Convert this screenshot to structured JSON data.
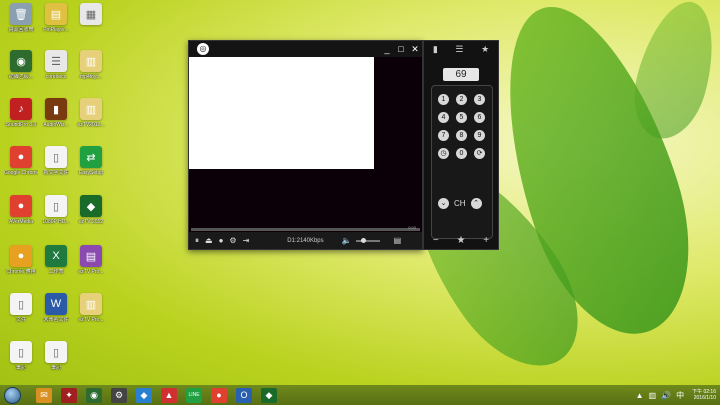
{
  "desktop": {
    "icons": [
      {
        "label": "資源回收筒",
        "glyph": "🗑",
        "color": "#8aa0b0"
      },
      {
        "label": "PotPlayer...",
        "glyph": "▤",
        "color": "#e0c040"
      },
      {
        "label": "",
        "glyph": "▦",
        "color": "#e8e8e8"
      },
      {
        "label": "紡織乙級...",
        "glyph": "◉",
        "color": "#2e6b2e"
      },
      {
        "label": "corelrecs",
        "glyph": "☰",
        "color": "#e8e8e8"
      },
      {
        "label": "mp4toyt...",
        "glyph": "▥",
        "color": "#e6d07a"
      },
      {
        "label": "SoundPro 3.0",
        "glyph": "♪",
        "color": "#c02020"
      },
      {
        "label": "AudioWiz...",
        "glyph": "▮",
        "color": "#7a3a10"
      },
      {
        "label": "ezTV2012...",
        "glyph": "▥",
        "color": "#e6d07a"
      },
      {
        "label": "Google Chrome",
        "glyph": "●",
        "color": "#e04030"
      },
      {
        "label": "新文字文件",
        "glyph": "▯",
        "color": "#f4f4f4"
      },
      {
        "label": "EasySetup",
        "glyph": "⇄",
        "color": "#20a040"
      },
      {
        "label": "AVerMedia",
        "glyph": "●",
        "color": "#e04030"
      },
      {
        "label": "1080P HD...",
        "glyph": "▯",
        "color": "#f4f4f4"
      },
      {
        "label": "ezTV 2012",
        "glyph": "◆",
        "color": "#1a6a2a"
      },
      {
        "label": "Chrome 應用",
        "glyph": "●",
        "color": "#e8a020"
      },
      {
        "label": "工作表",
        "glyph": "X",
        "color": "#1f7a40"
      },
      {
        "label": "ezTV Pro...",
        "glyph": "▤",
        "color": "#8a4ab0"
      },
      {
        "label": "文件",
        "glyph": "▯",
        "color": "#f4f4f4"
      },
      {
        "label": "未命名文件",
        "glyph": "W",
        "color": "#2a5aa8"
      },
      {
        "label": "ezTV Pro...",
        "glyph": "▥",
        "color": "#e6d07a"
      },
      {
        "label": "筆記",
        "glyph": "▯",
        "color": "#f4f4f4"
      },
      {
        "label": "筆記",
        "glyph": "▯",
        "color": "#f4f4f4"
      }
    ]
  },
  "player": {
    "logo": "◎",
    "minimize": "_",
    "maximize": "□",
    "close": "✕",
    "bitrate": "D1:2140Kbps",
    "seek_time": "0:00",
    "controls": [
      "⏸",
      "⏏",
      "●",
      "⚙",
      "⇥"
    ],
    "volume_icon": "🔈",
    "settings_icon": "▤",
    "volume_level": 0.3
  },
  "remote": {
    "top_icons": [
      "▮",
      "☰",
      "★"
    ],
    "channel": "69",
    "keys": [
      "1",
      "2",
      "3",
      "4",
      "5",
      "6",
      "7",
      "8",
      "9",
      "◷",
      "0",
      "⟳"
    ],
    "ch_label": "CH",
    "ch_down": "⌄",
    "ch_up": "⌃",
    "bottom_icons": [
      "−",
      "★",
      "+"
    ]
  },
  "taskbar": {
    "apps": [
      {
        "glyph": "✉",
        "color": "#d89020"
      },
      {
        "glyph": "✦",
        "color": "#a02020"
      },
      {
        "glyph": "◉",
        "color": "#2e6b2e"
      },
      {
        "glyph": "⚙",
        "color": "#444444"
      },
      {
        "glyph": "◆",
        "color": "#2a80d0"
      },
      {
        "glyph": "▲",
        "color": "#d03030"
      },
      {
        "glyph": "LINE",
        "color": "#20a040"
      },
      {
        "glyph": "●",
        "color": "#e04030"
      },
      {
        "glyph": "O",
        "color": "#2a60b0"
      },
      {
        "glyph": "◆",
        "color": "#1a6a2a"
      }
    ],
    "tray": {
      "up": "▲",
      "network": "▥",
      "volume": "🔊",
      "ime": "中"
    },
    "clock_time": "下午 02:16",
    "clock_date": "2016/1/10"
  }
}
